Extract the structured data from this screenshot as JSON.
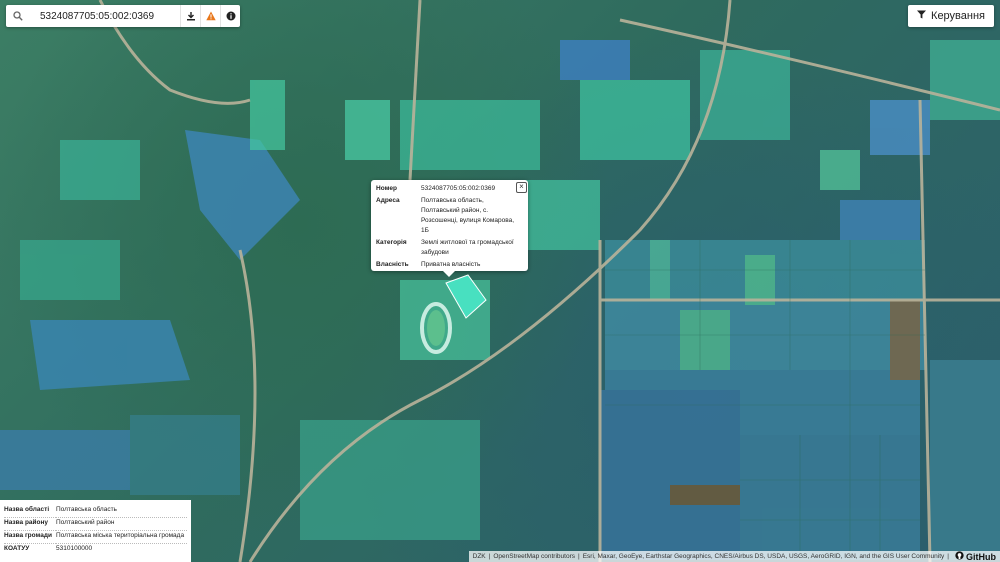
{
  "search": {
    "value": "5324087705:05:002:0369"
  },
  "icons": {
    "search": "search-icon",
    "download": "download-icon",
    "warning": "warning-icon",
    "info": "info-icon",
    "filter": "filter-icon",
    "close": "close-icon",
    "github": "github-icon"
  },
  "control": {
    "label": "Керування"
  },
  "popup": {
    "rows": [
      {
        "key": "Номер",
        "value": "5324087705:05:002:0369"
      },
      {
        "key": "Адреса",
        "value": "Полтавська область, Полтавський район, с. Розсошенці, вулиця Комарова, 1Б"
      },
      {
        "key": "Категорія",
        "value": "Землі житлової та громадської забудови"
      },
      {
        "key": "Власність",
        "value": "Приватна власність"
      }
    ],
    "close_label": "×"
  },
  "info": {
    "rows": [
      {
        "key": "Назва області",
        "value": "Полтавська область"
      },
      {
        "key": "Назва району",
        "value": "Полтавський район"
      },
      {
        "key": "Назва громади",
        "value": "Полтавська міська територіальна громада"
      },
      {
        "key": "КОАТУУ",
        "value": "5310100000"
      }
    ]
  },
  "attribution": {
    "dzk": "DZK",
    "osm": "OpenStreetMap contributors",
    "esri": "Esri, Maxar, GeoEye, Earthstar Geographics, CNES/Airbus DS, USDA, USGS, AeroGRID, IGN, and the GIS User Community",
    "github": "GitHub"
  },
  "colors": {
    "parcel_fill": "#3fd6b4",
    "parcel_blue": "#3d8fc7",
    "road": "#b9b39a"
  }
}
